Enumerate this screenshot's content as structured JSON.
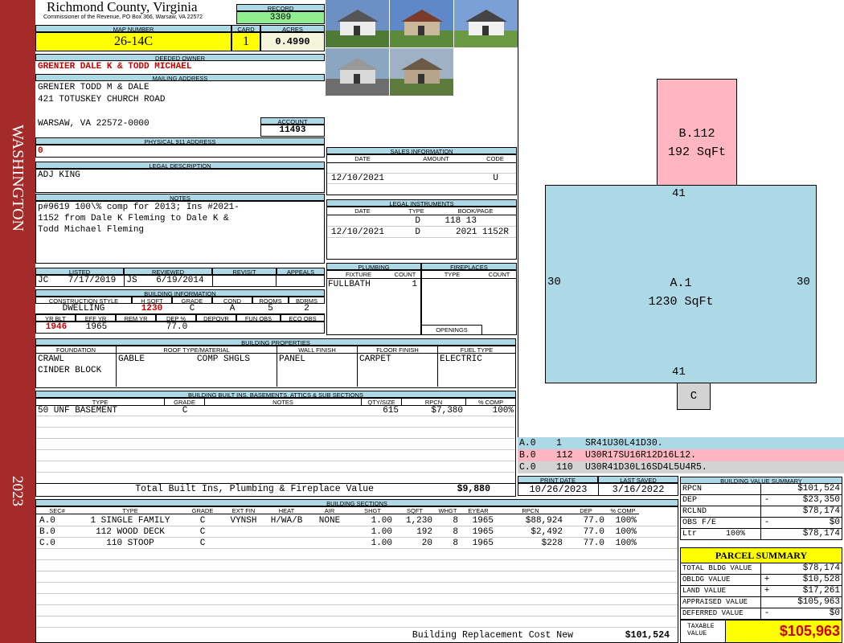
{
  "side": {
    "top": "WASHINGTON",
    "bottom": "2023"
  },
  "header": {
    "county": "Richmond County, Virginia",
    "commissioner": "Commissioner of the Revenue, PO Box 366, Warsaw, VA 22572",
    "record_label": "RECORD",
    "record": "3309",
    "map_label": "MAP NUMBER",
    "map": "26-14C",
    "card_label": "CARD",
    "card": "1",
    "acres_label": "ACRES",
    "acres": "0.4990"
  },
  "owner": {
    "label": "DEEDED OWNER",
    "name": "GRENIER DALE K & TODD MICHAEL",
    "mail_label": "MAILING ADDRESS",
    "mail1": "GRENIER TODD M & DALE",
    "mail2": "421 TOTUSKEY CHURCH ROAD",
    "mail3": "WARSAW, VA 22572-0000",
    "account_label": "ACCOUNT",
    "account": "11493",
    "phys_label": "PHYSICAL 911 ADDRESS",
    "phys": "0"
  },
  "legal": {
    "label": "LEGAL DESCRIPTION",
    "value": "ADJ KING"
  },
  "notes": {
    "label": "NOTES",
    "l1": "p#9619 100\\% comp for 2013; Ins #2021-",
    "l2": "1152 from Dale K Fleming to Dale K &",
    "l3": "Todd Michael Fleming"
  },
  "sales": {
    "label": "SALES INFORMATION",
    "h_date": "DATE",
    "h_amount": "AMOUNT",
    "h_code": "CODE",
    "date": "12/10/2021",
    "code": "U"
  },
  "instruments": {
    "label": "LEGAL INSTRUMENTS",
    "h_date": "DATE",
    "h_type": "TYPE",
    "h_book": "BOOK/PAGE",
    "r1_type": "D",
    "r1_book": "118 13",
    "r2_date": "12/10/2021",
    "r2_type": "D",
    "r2_book": "2021 1152R"
  },
  "plumbing": {
    "label": "PLUMBING",
    "h_fixture": "FIXTURE",
    "h_count": "COUNT",
    "fixture": "FULLBATH",
    "count": "1"
  },
  "fireplaces": {
    "label": "FIREPLACES",
    "h_type": "TYPE",
    "h_count": "COUNT",
    "openings": "OPENINGS"
  },
  "listed": {
    "h_listed": "LISTED",
    "h_reviewed": "REVIEWED",
    "h_revisit": "REVISIT",
    "h_appeals": "APPEALS",
    "lby": "JC",
    "ldate": "7/17/2019",
    "rby": "JS",
    "rdate": "6/19/2014"
  },
  "bi": {
    "label": "BUILDING INFORMATION",
    "h_cs": "CONSTRUCTION STYLE",
    "h_hsqft": "H SQFT",
    "h_grade": "GRADE",
    "h_cond": "COND",
    "h_rooms": "ROOMS",
    "h_bdrms": "BDRMS",
    "cs": "DWELLING",
    "hsqft": "1230",
    "grade": "C",
    "cond": "A",
    "rooms": "5",
    "bdrms": "2",
    "h_yrblt": "YR BLT",
    "h_effyr": "EFF YR",
    "h_remyr": "REM YR",
    "h_dep": "DEP %",
    "h_depovr": "DEPOVR",
    "h_funobs": "FUN OBS",
    "h_ecoobs": "ECO OBS",
    "yrblt": "1946",
    "effyr": "1965",
    "dep": "77.0"
  },
  "bp": {
    "label": "BUILDING PROPERTIES",
    "h_found": "FOUNDATION",
    "h_roof": "ROOF TYPE/MATERIAL",
    "h_wall": "WALL FINISH",
    "h_floor": "FLOOR FINISH",
    "h_fuel": "FUEL TYPE",
    "found1": "CRAWL",
    "found2": "CINDER BLOCK",
    "roof1": "GABLE",
    "roof2": "COMP SHGLS",
    "wall": "PANEL",
    "floor": "CARPET",
    "fuel": "ELECTRIC"
  },
  "bis": {
    "label": "BUILDING BUILT INS, BASEMENTS, ATTICS & SUB SECTIONS",
    "h_type": "TYPE",
    "h_grade": "GRADE",
    "h_notes": "NOTES",
    "h_qty": "QTY/SIZE",
    "h_rpcn": "RPCN",
    "h_comp": "% COMP",
    "type": "50 UNF BASEMENT",
    "grade": "C",
    "qty": "615",
    "rpcn": "$7,380",
    "comp": "100%",
    "total_label": "Total Built Ins, Plumbing & Fireplace Value",
    "total": "$9,880"
  },
  "sketch": {
    "b_label": "B.112",
    "b_area": "192 SqFt",
    "a_label": "A.1",
    "a_area": "1230 SqFt",
    "c_label": "C",
    "top": "41",
    "bottom": "41",
    "left": "30",
    "right": "30"
  },
  "legend": [
    {
      "sec": "A.0",
      "code": "1",
      "path": "SR41U30L41D30.",
      "color": "#add8e6"
    },
    {
      "sec": "B.0",
      "code": "112",
      "path": "U30R17SU16R12D16L12.",
      "color": "#ffb6c1"
    },
    {
      "sec": "C.0",
      "code": "110",
      "path": "U30R41D30L16SD4L5U4R5.",
      "color": "#d3d3d3"
    }
  ],
  "dates": {
    "h_print": "PRINT DATE",
    "h_saved": "LAST SAVED",
    "print": "10/26/2023",
    "saved": "3/16/2022"
  },
  "sections": {
    "label": "BUILDING SECTIONS",
    "headers": [
      "SEC#",
      "TYPE",
      "GRADE",
      "EXT FIN",
      "HEAT",
      "AIR",
      "SHGT",
      "SQFT",
      "WHGT",
      "EYEAR",
      "RPCN",
      "DEP",
      "% COMP"
    ],
    "rows": [
      [
        "A.0",
        "1 SINGLE FAMILY",
        "C",
        "VYNSH",
        "H/WA/B",
        "NONE",
        "1.00",
        "1,230",
        "8",
        "1965",
        "$88,924",
        "77.0",
        "100%"
      ],
      [
        "B.0",
        "112 WOOD DECK",
        "C",
        "",
        "",
        "",
        "1.00",
        "192",
        "8",
        "1965",
        "$2,492",
        "77.0",
        "100%"
      ],
      [
        "C.0",
        "110 STOOP",
        "C",
        "",
        "",
        "",
        "1.00",
        "20",
        "8",
        "1965",
        "$228",
        "77.0",
        "100%"
      ]
    ],
    "brcn_label": "Building Replacement Cost New",
    "brcn": "$101,524"
  },
  "bvs": {
    "label": "BUILDING VALUE SUMMARY",
    "rows": [
      {
        "k": "RPCN",
        "s": "",
        "v": "$101,524"
      },
      {
        "k": "DEP",
        "s": "-",
        "v": "$23,350"
      },
      {
        "k": "RCLND",
        "s": "",
        "v": "$78,174"
      },
      {
        "k": "OBS F/E",
        "s": "-",
        "v": "$0"
      },
      {
        "k": "Ltr",
        "p": "100%",
        "s": "",
        "v": "$78,174"
      }
    ]
  },
  "ps": {
    "label": "PARCEL SUMMARY",
    "rows": [
      {
        "k": "TOTAL BLDG VALUE",
        "s": "",
        "v": "$78,174"
      },
      {
        "k": "OBLDG VALUE",
        "s": "+",
        "v": "$10,528"
      },
      {
        "k": "LAND VALUE",
        "s": "+",
        "v": "$17,261"
      },
      {
        "k": "APPRAISED VALUE",
        "s": "",
        "v": "$105,963"
      },
      {
        "k": "DEFERRED VALUE",
        "s": "-",
        "v": "$0"
      }
    ],
    "taxable_label": "TAXABLE VALUE",
    "taxable": "$105,963"
  },
  "photos": [
    {
      "sky": "#6c8fc4",
      "ground": "#4f7a35",
      "house": "#ececec",
      "roof": "#555"
    },
    {
      "sky": "#5e88c8",
      "ground": "#5c8a3a",
      "house": "#c9b89a",
      "roof": "#7a3b2a"
    },
    {
      "sky": "#7aa0d6",
      "ground": "#6b9a45",
      "house": "#f1f1f1",
      "roof": "#444"
    },
    {
      "sky": "#8aa6c0",
      "ground": "#6e6e6e",
      "house": "#d8d8d8",
      "roof": "#999"
    },
    {
      "sky": "#9fb1c4",
      "ground": "#5d7b3d",
      "house": "#b7a48a",
      "roof": "#6b5a48"
    }
  ]
}
